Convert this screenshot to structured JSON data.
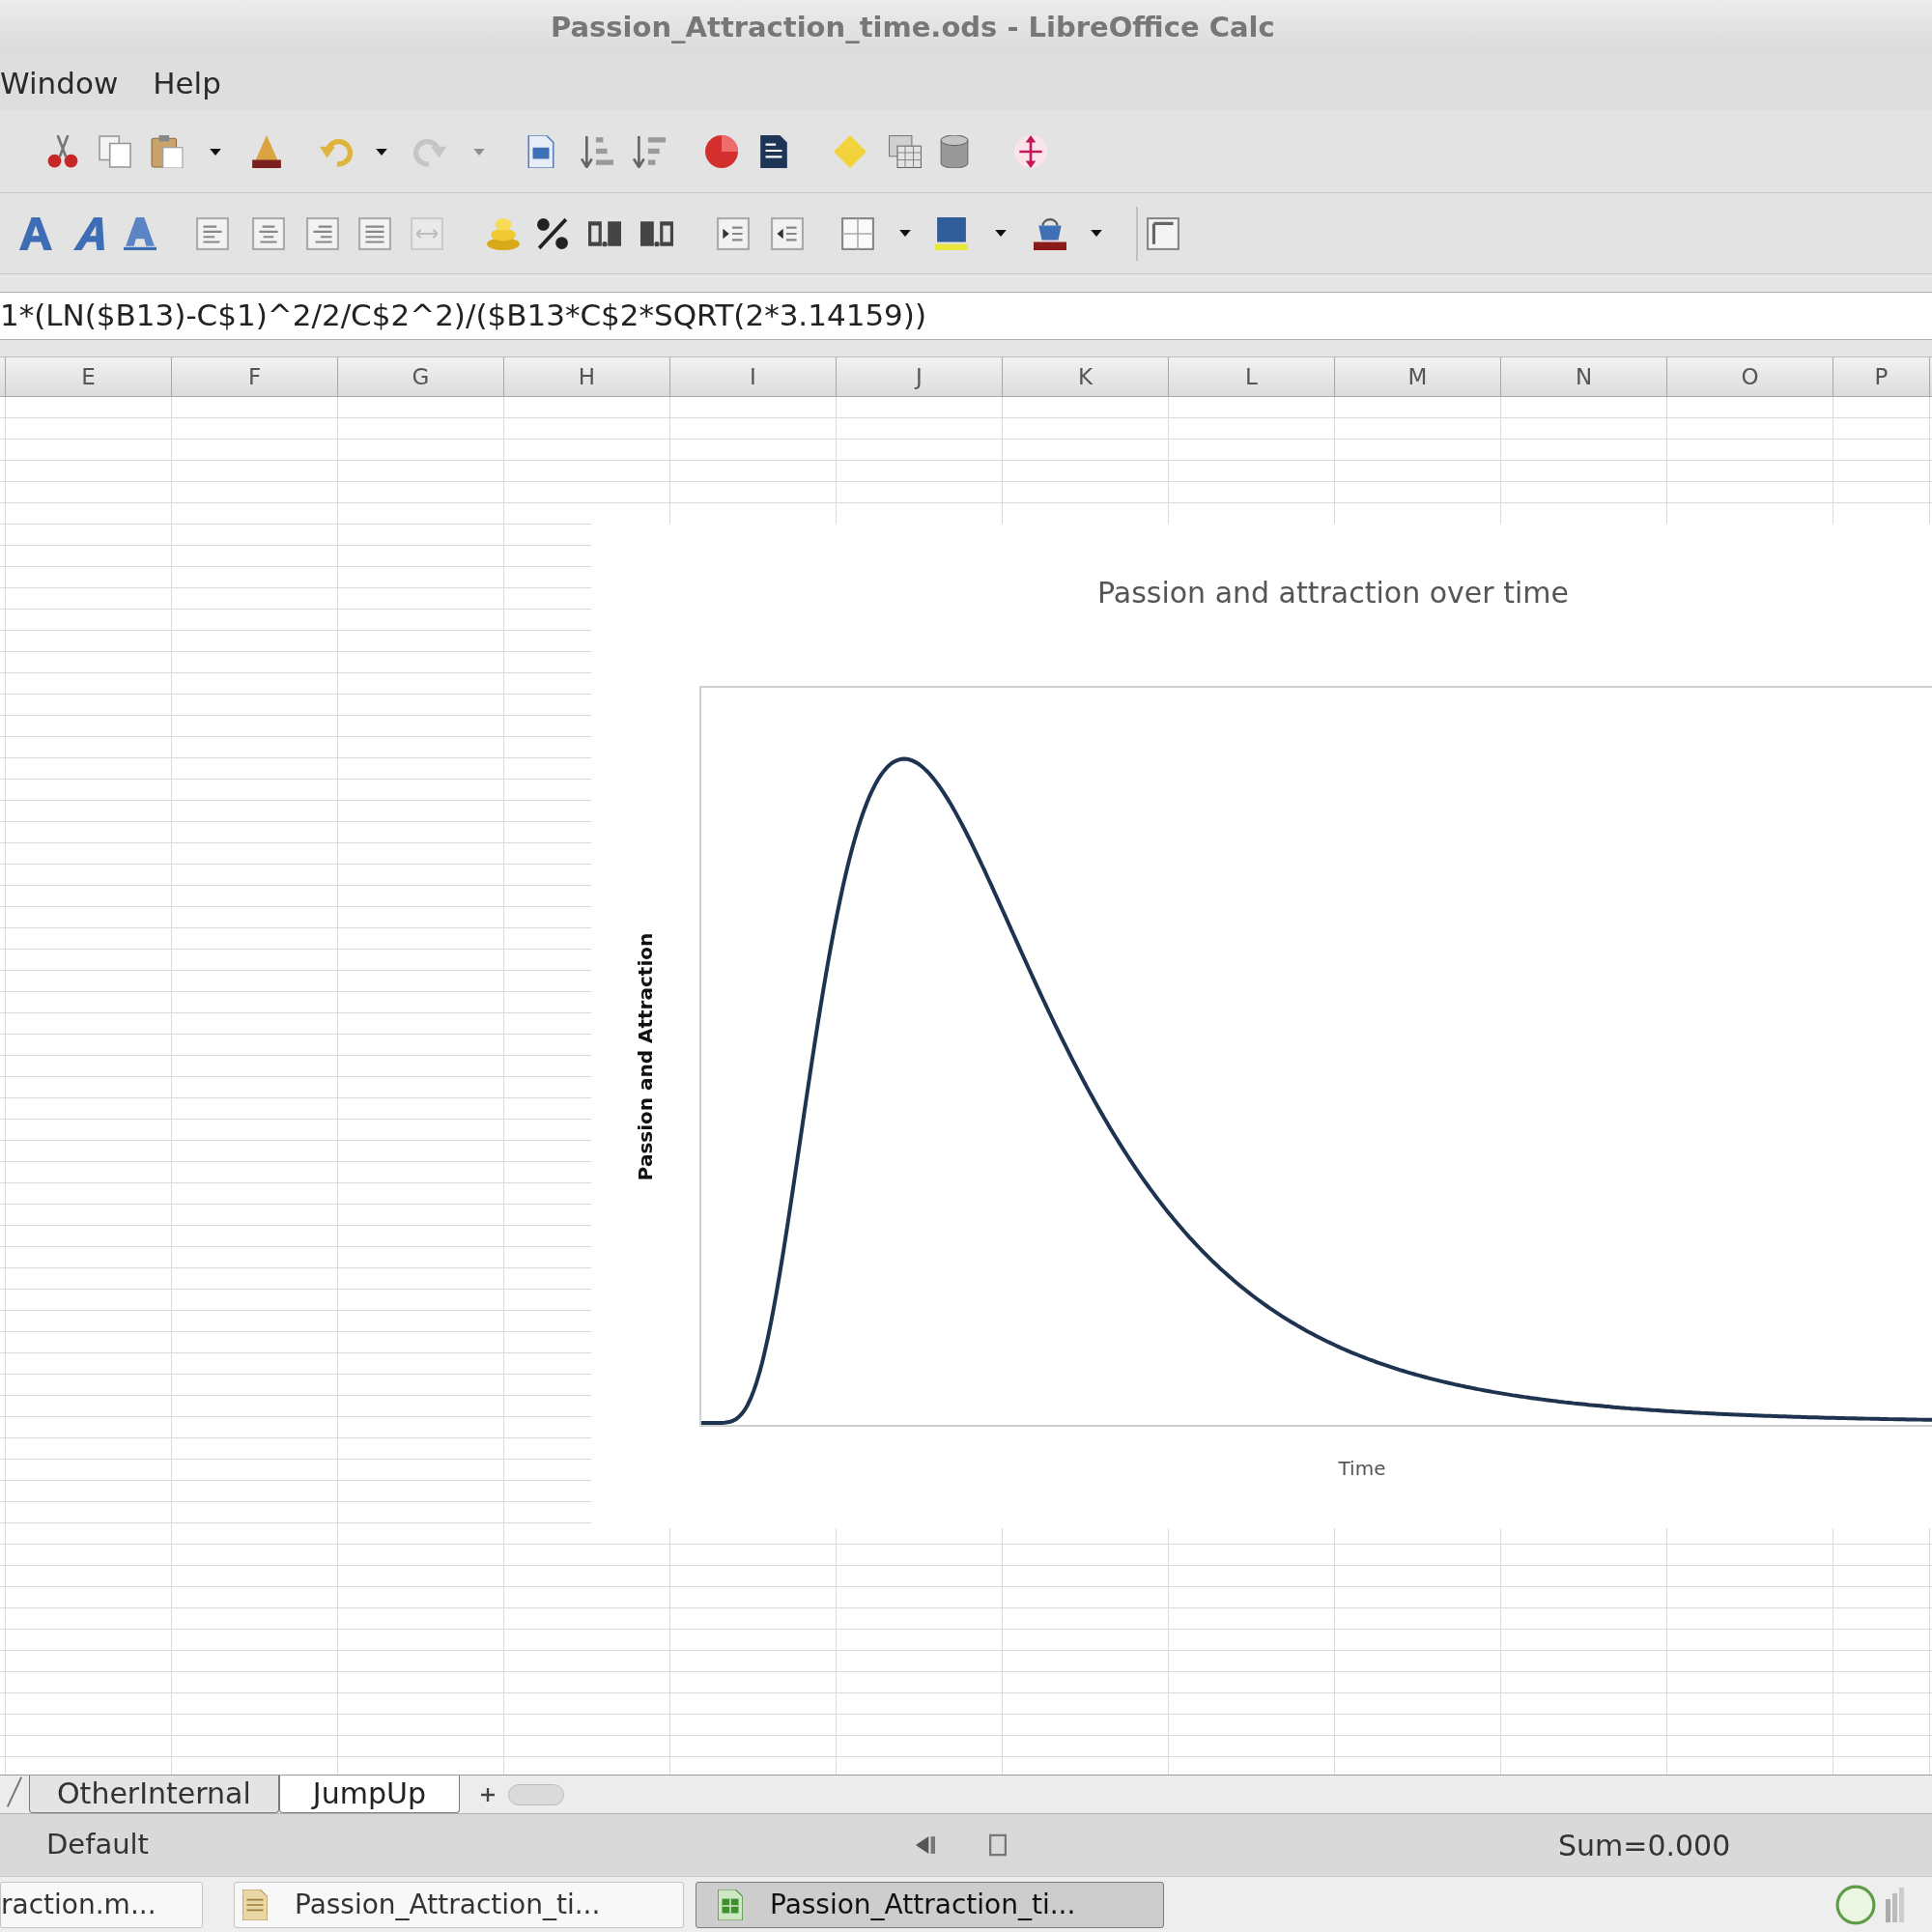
{
  "window": {
    "title": "Passion_Attraction_time.ods - LibreOffice Calc"
  },
  "menu": [
    "Window",
    "Help"
  ],
  "toolbars": [
    {
      "buttons": [
        {
          "disabled": false
        },
        {
          "disabled": false
        },
        {
          "disabled": false
        },
        {
          "disabled": false
        },
        {
          "disabled": false
        },
        {
          "disabled": true
        },
        {
          "disabled": false
        },
        {
          "disabled": false
        },
        {
          "disabled": false
        },
        {
          "disabled": false
        },
        {
          "disabled": false
        },
        {
          "disabled": false
        },
        {
          "disabled": false
        },
        {
          "disabled": false
        },
        {
          "disabled": false
        }
      ]
    },
    {
      "buttons": [
        {
          "disabled": false
        },
        {
          "disabled": false
        },
        {
          "disabled": false
        },
        {
          "disabled": false
        },
        {
          "disabled": false
        },
        {
          "disabled": false
        },
        {
          "disabled": false
        },
        {
          "disabled": true
        },
        {
          "disabled": false
        },
        {
          "disabled": false
        },
        {
          "disabled": false
        },
        {
          "disabled": false
        },
        {
          "disabled": false
        },
        {
          "disabled": false
        },
        {
          "disabled": false
        },
        {
          "disabled": false
        },
        {
          "disabled": false
        },
        {
          "disabled": false
        }
      ]
    }
  ],
  "formula_bar": {
    "value": "1*(LN($B13)-C$1)^2/2/C$2^2)/($B13*C$2*SQRT(2*3.14159))"
  },
  "columns": [
    "E",
    "F",
    "G",
    "H",
    "I",
    "J",
    "K",
    "L",
    "M",
    "N",
    "O",
    "P"
  ],
  "chart": {
    "title": "Passion and attraction over time",
    "ylabel": "Passion and Attraction",
    "xlabel": "Time"
  },
  "sheet_tabs": [
    {
      "label": "OtherInternal",
      "selected": false
    },
    {
      "label": "JumpUp",
      "selected": true
    }
  ],
  "status_bar": {
    "style": "Default",
    "sum": "Sum=0.000"
  },
  "taskbar": [
    {
      "label": "raction.m...",
      "kind": "plain",
      "selected": false
    },
    {
      "label": "Passion_Attraction_ti...",
      "kind": "document",
      "selected": false
    },
    {
      "label": "Passion_Attraction_ti...",
      "kind": "spreadsheet",
      "selected": true
    }
  ]
}
